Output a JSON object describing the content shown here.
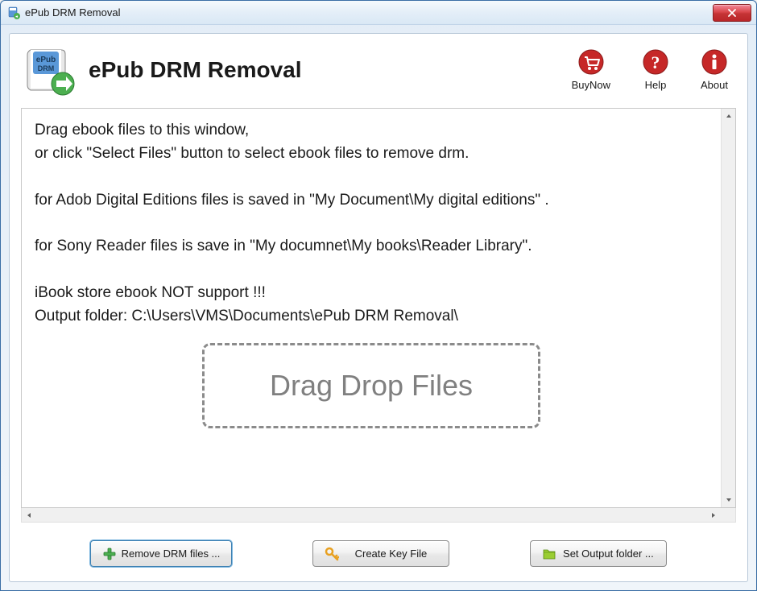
{
  "window": {
    "title": "ePub DRM Removal"
  },
  "header": {
    "appTitle": "ePub DRM Removal"
  },
  "toolbar": {
    "buyNow": "BuyNow",
    "help": "Help",
    "about": "About"
  },
  "instructions": {
    "line1": "Drag ebook files to this window,",
    "line2": "or click \"Select Files\" button to select ebook files to remove drm.",
    "line3": "for Adob Digital Editions files is saved in \"My Document\\My digital editions\" .",
    "line4": "for Sony Reader files is save in \"My documnet\\My books\\Reader Library\".",
    "line5": "iBook store ebook NOT support !!!",
    "line6": "Output folder: C:\\Users\\VMS\\Documents\\ePub DRM Removal\\"
  },
  "dropZone": {
    "label": "Drag Drop Files"
  },
  "buttons": {
    "removeDrm": "Remove DRM files ...",
    "createKey": "Create Key File",
    "setOutput": "Set Output folder ..."
  }
}
